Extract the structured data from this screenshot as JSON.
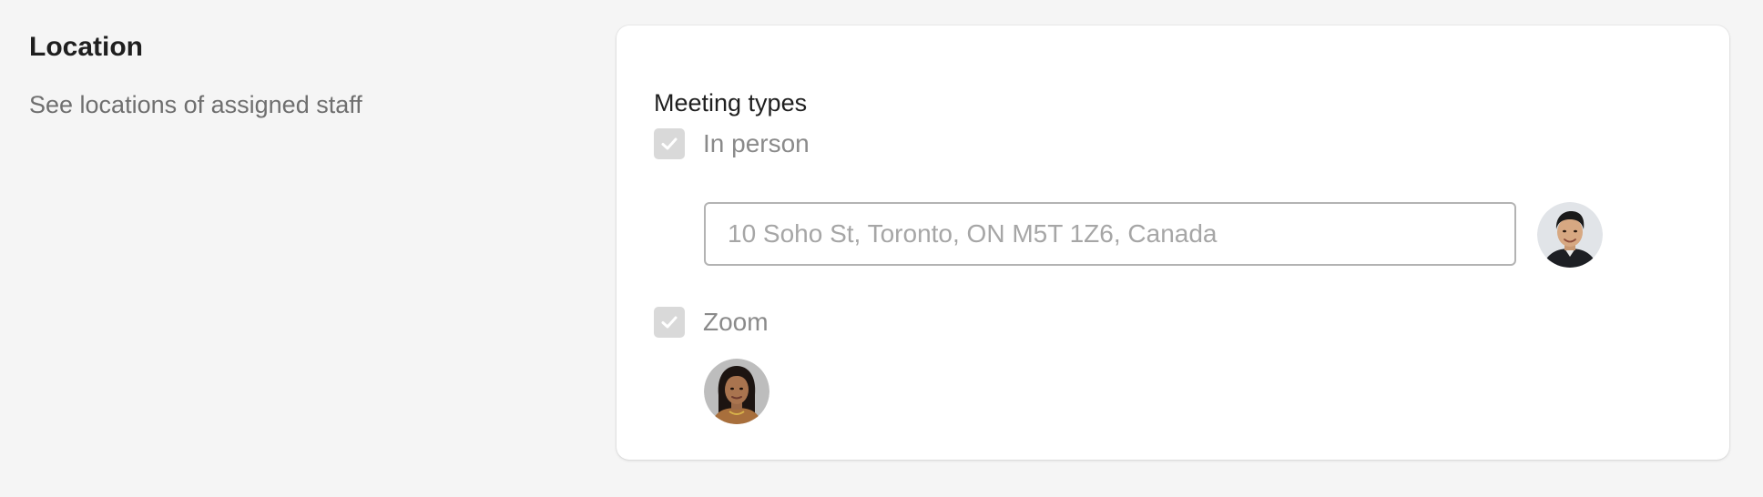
{
  "section": {
    "title": "Location",
    "description": "See locations of assigned staff"
  },
  "card": {
    "group_label": "Meeting types",
    "options": [
      {
        "label": "In person",
        "checked": true,
        "disabled": true,
        "address_placeholder": "10 Soho St, Toronto, ON M5T 1Z6, Canada",
        "assigned_staff_avatar": "avatar-man"
      },
      {
        "label": "Zoom",
        "checked": true,
        "disabled": true,
        "assigned_staff_avatar": "avatar-woman"
      }
    ]
  },
  "icons": {
    "checkbox_mark": "check-icon"
  },
  "colors": {
    "background": "#f5f5f5",
    "card": "#ffffff",
    "checkbox_disabled": "#d9d9d9",
    "muted_text": "#8a8a8a"
  }
}
